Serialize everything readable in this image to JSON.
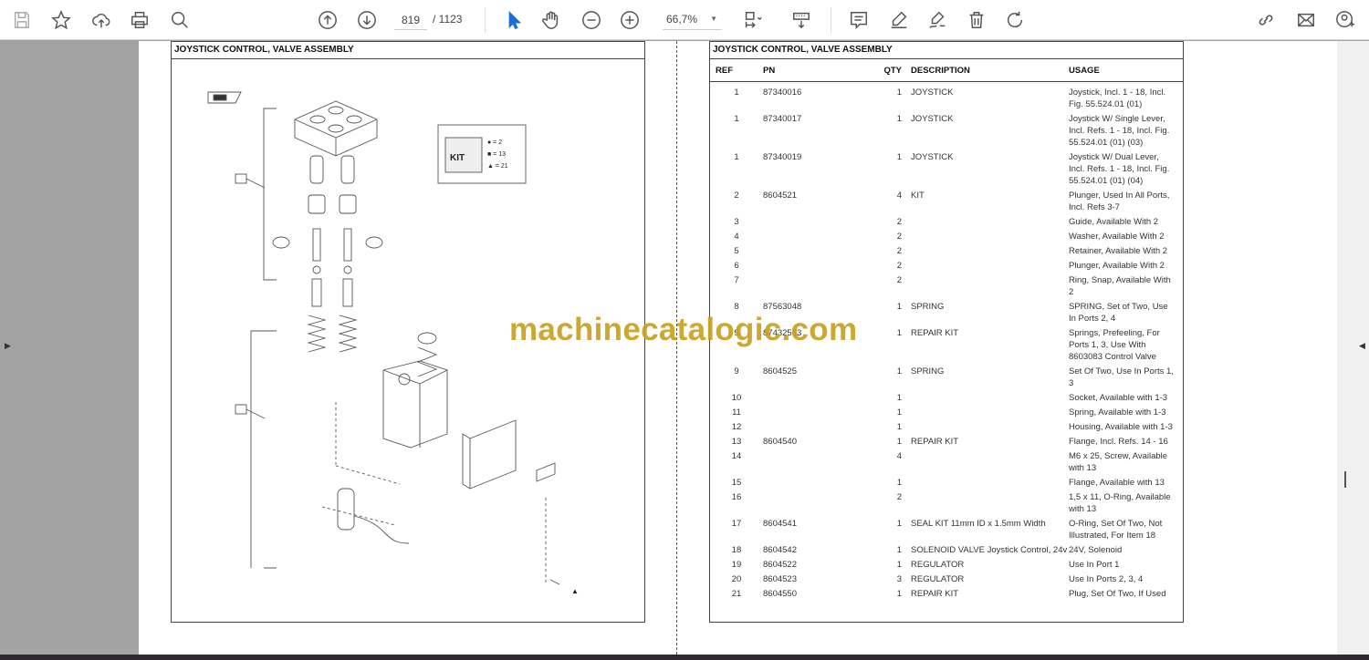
{
  "toolbar": {
    "current_page": "819",
    "total_pages": "/ 1123",
    "zoom": "66,7%",
    "icons": [
      "save-icon",
      "star-icon",
      "upload-icon",
      "print-icon",
      "zoom-search-icon",
      "page-up-icon",
      "page-down-icon",
      "select-cursor-icon",
      "hand-icon",
      "zoom-out-icon",
      "zoom-in-icon",
      "fit-page-icon",
      "scroll-mode-icon",
      "comment-icon",
      "highlight-icon",
      "sign-icon",
      "delete-icon",
      "rotate-icon",
      "link-icon",
      "email-icon",
      "user-icon"
    ]
  },
  "left_panel": {
    "title": "JOYSTICK CONTROL, VALVE ASSEMBLY",
    "kit_legend": [
      "● = 2",
      "■ = 13",
      "▲ = 21"
    ],
    "kit_label": "KIT"
  },
  "right_panel": {
    "title": "JOYSTICK CONTROL, VALVE ASSEMBLY",
    "columns": [
      "REF",
      "PN",
      "QTY",
      "DESCRIPTION",
      "USAGE"
    ],
    "rows": [
      [
        "1",
        "87340016",
        "1",
        "JOYSTICK",
        "Joystick,  Incl. 1 - 18, Incl. Fig. 55.524.01 (01)"
      ],
      [
        "1",
        "87340017",
        "1",
        "JOYSTICK",
        "Joystick W/ Single Lever, Incl. Refs. 1 - 18, Incl. Fig. 55.524.01 (01) (03)"
      ],
      [
        "1",
        "87340019",
        "1",
        "JOYSTICK",
        "Joystick W/ Dual Lever,  Incl. Refs. 1 - 18, Incl. Fig. 55.524.01 (01) (04)"
      ],
      [
        "2",
        "8604521",
        "4",
        "KIT",
        "Plunger, Used In All Ports, Incl. Refs 3-7"
      ],
      [
        "3",
        "",
        "2",
        "",
        "Guide, Available With 2"
      ],
      [
        "4",
        "",
        "2",
        "",
        "Washer, Available With 2"
      ],
      [
        "5",
        "",
        "2",
        "",
        "Retainer, Available With 2"
      ],
      [
        "6",
        "",
        "2",
        "",
        "Plunger, Available With 2"
      ],
      [
        "7",
        "",
        "2",
        "",
        "Ring, Snap, Available With 2"
      ],
      [
        "8",
        "87563048",
        "1",
        "SPRING",
        "SPRING, Set of Two, Use In Ports 2, 4"
      ],
      [
        "9",
        "87432563",
        "1",
        "REPAIR KIT",
        "Springs, Prefeeling, For Ports 1, 3, Use With 8603083 Control Valve"
      ],
      [
        "9",
        "8604525",
        "1",
        "SPRING",
        "Set Of Two, Use In Ports 1, 3"
      ],
      [
        "10",
        "",
        "1",
        "",
        "Socket, Available with 1-3"
      ],
      [
        "11",
        "",
        "1",
        "",
        "Spring, Available with 1-3"
      ],
      [
        "12",
        "",
        "1",
        "",
        "Housing, Available with 1-3"
      ],
      [
        "13",
        "8604540",
        "1",
        "REPAIR KIT",
        "Flange, Incl. Refs. 14 - 16"
      ],
      [
        "14",
        "",
        "4",
        "",
        "M6 x 25, Screw, Available with 13"
      ],
      [
        "15",
        "",
        "1",
        "",
        "Flange, Available with 13"
      ],
      [
        "16",
        "",
        "2",
        "",
        "1,5 x 11, O-Ring, Available with 13"
      ],
      [
        "17",
        "8604541",
        "1",
        "SEAL KIT 11mm ID x 1.5mm Width",
        "O-Ring, Set Of Two, Not Illustrated, For Item 18"
      ],
      [
        "18",
        "8604542",
        "1",
        "SOLENOID VALVE Joystick Control, 24v",
        "24V, Solenoid"
      ],
      [
        "19",
        "8604522",
        "1",
        "REGULATOR",
        "Use In Port 1"
      ],
      [
        "20",
        "8604523",
        "3",
        "REGULATOR",
        "Use In Ports 2, 3, 4"
      ],
      [
        "21",
        "8604550",
        "1",
        "REPAIR KIT",
        "Plug, Set Of Two,  If Used"
      ]
    ]
  },
  "watermark": "machinecatalogic.com"
}
